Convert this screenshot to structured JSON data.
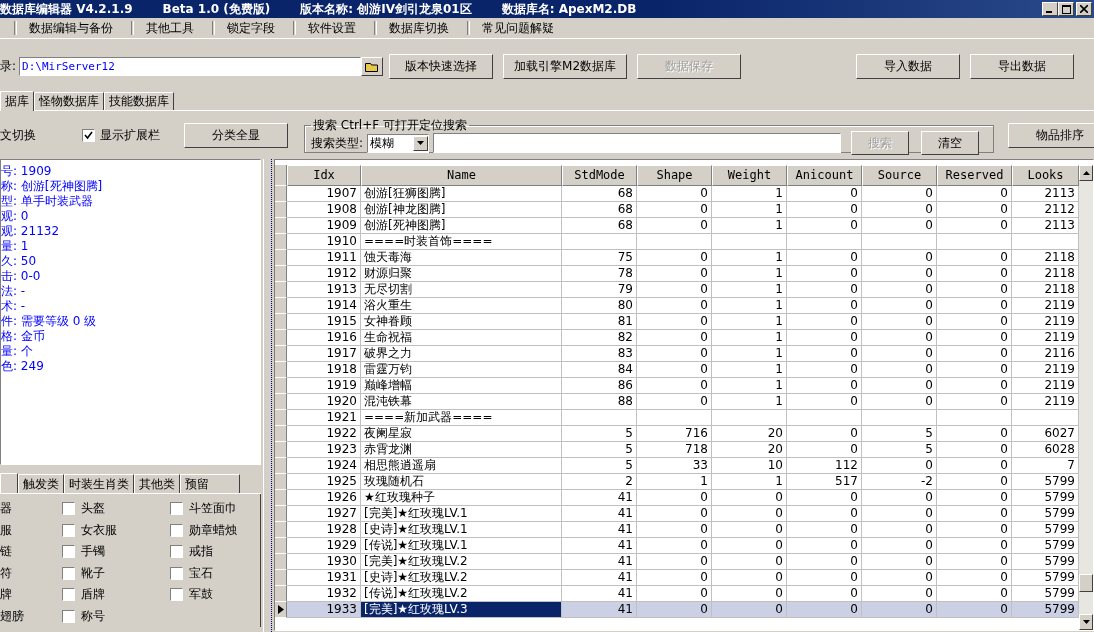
{
  "window": {
    "title_parts": [
      "数据库编辑器 V4.2.1.9",
      "Beta 1.0 (免费版)",
      "版本名称: 创游IV剑引龙泉01区",
      "数据库名: ApexM2.DB"
    ]
  },
  "menu": [
    "数据编辑与备份",
    "其他工具",
    "锁定字段",
    "软件设置",
    "数据库切换",
    "常见问题解疑"
  ],
  "path_bar": {
    "label": "录:",
    "value": "D:\\MirServer12"
  },
  "left_buttons": [
    {
      "label": "版本快速选择",
      "disabled": false
    },
    {
      "label": "加载引擎M2数据库",
      "disabled": false
    },
    {
      "label": "数据保存",
      "disabled": true
    }
  ],
  "right_buttons": [
    {
      "label": "导入数据",
      "disabled": false
    },
    {
      "label": "导出数据",
      "disabled": false
    }
  ],
  "tabs": [
    {
      "label": "据库",
      "selected": true
    },
    {
      "label": "怪物数据库",
      "selected": false
    },
    {
      "label": "技能数据库",
      "selected": false
    }
  ],
  "options": {
    "label": "文切换",
    "show_ext": {
      "label": "显示扩展栏",
      "checked": true
    },
    "show_all_button": "分类全显"
  },
  "search": {
    "legend": "搜索  Ctrl+F 可打开定位搜索",
    "type_label": "搜索类型:",
    "type_value": "模糊",
    "search_button": {
      "label": "搜索",
      "disabled": true
    },
    "clear_button": "清空"
  },
  "sort_button": "物品排序",
  "details": [
    "号: 1909",
    "称: 创游[死神图腾]",
    "型: 单手时装武器",
    "观: 0",
    "观: 21132",
    "量: 1",
    "久: 50",
    "击: 0-0",
    "法: -",
    "术: -",
    "件: 需要等级 0 级",
    "格: 金币",
    "量: 个",
    "色: 249"
  ],
  "category_tabs": [
    "触发类",
    "时装生肖类",
    "其他类",
    "预留"
  ],
  "categories": [
    {
      "label": "器"
    },
    {
      "label": "头盔",
      "checked": false
    },
    {
      "label": "斗笠面巾",
      "checked": false
    },
    {
      "label": "服"
    },
    {
      "label": "女衣服",
      "checked": false
    },
    {
      "label": "勋章蜡烛",
      "checked": false
    },
    {
      "label": "链"
    },
    {
      "label": "手镯",
      "checked": false
    },
    {
      "label": "戒指",
      "checked": false
    },
    {
      "label": "符"
    },
    {
      "label": "靴子",
      "checked": false
    },
    {
      "label": "宝石",
      "checked": false
    },
    {
      "label": "牌"
    },
    {
      "label": "盾牌",
      "checked": false
    },
    {
      "label": "军鼓",
      "checked": false
    },
    {
      "label": "翅膀"
    },
    {
      "label": "称号",
      "checked": false
    }
  ],
  "table": {
    "columns": [
      "Idx",
      "Name",
      "StdMode",
      "Shape",
      "Weight",
      "Anicount",
      "Source",
      "Reserved",
      "Looks"
    ],
    "rows": [
      {
        "idx": "1907",
        "name": "创游[狂狮图腾]",
        "values": [
          "68",
          "0",
          "1",
          "0",
          "0",
          "0",
          "2113"
        ],
        "selected": false
      },
      {
        "idx": "1908",
        "name": "创游[神龙图腾]",
        "values": [
          "68",
          "0",
          "1",
          "0",
          "0",
          "0",
          "2112"
        ],
        "selected": false
      },
      {
        "idx": "1909",
        "name": "创游[死神图腾]",
        "values": [
          "68",
          "0",
          "1",
          "0",
          "0",
          "0",
          "2113"
        ],
        "selected": false
      },
      {
        "idx": "1910",
        "name": "====时装首饰====",
        "selected": false
      },
      {
        "idx": "1911",
        "name": "蚀天毒海",
        "values": [
          "75",
          "0",
          "1",
          "0",
          "0",
          "0",
          "2118"
        ],
        "selected": false
      },
      {
        "idx": "1912",
        "name": "财源归聚",
        "values": [
          "78",
          "0",
          "1",
          "0",
          "0",
          "0",
          "2118"
        ],
        "selected": false
      },
      {
        "idx": "1913",
        "name": "无尽切割",
        "values": [
          "79",
          "0",
          "1",
          "0",
          "0",
          "0",
          "2118"
        ],
        "selected": false
      },
      {
        "idx": "1914",
        "name": "浴火重生",
        "values": [
          "80",
          "0",
          "1",
          "0",
          "0",
          "0",
          "2119"
        ],
        "selected": false
      },
      {
        "idx": "1915",
        "name": "女神眷顾",
        "values": [
          "81",
          "0",
          "1",
          "0",
          "0",
          "0",
          "2119"
        ],
        "selected": false
      },
      {
        "idx": "1916",
        "name": "生命祝福",
        "values": [
          "82",
          "0",
          "1",
          "0",
          "0",
          "0",
          "2119"
        ],
        "selected": false
      },
      {
        "idx": "1917",
        "name": "破界之力",
        "values": [
          "83",
          "0",
          "1",
          "0",
          "0",
          "0",
          "2116"
        ],
        "selected": false
      },
      {
        "idx": "1918",
        "name": "雷霆万钧",
        "values": [
          "84",
          "0",
          "1",
          "0",
          "0",
          "0",
          "2119"
        ],
        "selected": false
      },
      {
        "idx": "1919",
        "name": "巅峰增幅",
        "values": [
          "86",
          "0",
          "1",
          "0",
          "0",
          "0",
          "2119"
        ],
        "selected": false
      },
      {
        "idx": "1920",
        "name": "混沌铁幕",
        "values": [
          "88",
          "0",
          "1",
          "0",
          "0",
          "0",
          "2119"
        ],
        "selected": false
      },
      {
        "idx": "1921",
        "name": "====新加武器====",
        "selected": false
      },
      {
        "idx": "1922",
        "name": "夜阑星寂",
        "values": [
          "5",
          "716",
          "20",
          "0",
          "5",
          "0",
          "6027"
        ],
        "selected": false
      },
      {
        "idx": "1923",
        "name": "赤霄龙渊",
        "values": [
          "5",
          "718",
          "20",
          "0",
          "5",
          "0",
          "6028"
        ],
        "selected": false
      },
      {
        "idx": "1924",
        "name": "相思熊逍遥扇",
        "values": [
          "5",
          "33",
          "10",
          "112",
          "0",
          "0",
          "7"
        ],
        "selected": false
      },
      {
        "idx": "1925",
        "name": "玫瑰随机石",
        "values": [
          "2",
          "1",
          "1",
          "517",
          "-2",
          "0",
          "5799"
        ],
        "selected": false
      },
      {
        "idx": "1926",
        "name": "★红玫瑰种子",
        "values": [
          "41",
          "0",
          "0",
          "0",
          "0",
          "0",
          "5799"
        ],
        "selected": false
      },
      {
        "idx": "1927",
        "name": "[完美]★红玫瑰LV.1",
        "values": [
          "41",
          "0",
          "0",
          "0",
          "0",
          "0",
          "5799"
        ],
        "selected": false
      },
      {
        "idx": "1928",
        "name": "[史诗]★红玫瑰LV.1",
        "values": [
          "41",
          "0",
          "0",
          "0",
          "0",
          "0",
          "5799"
        ],
        "selected": false
      },
      {
        "idx": "1929",
        "name": "[传说]★红玫瑰LV.1",
        "values": [
          "41",
          "0",
          "0",
          "0",
          "0",
          "0",
          "5799"
        ],
        "selected": false
      },
      {
        "idx": "1930",
        "name": "[完美]★红玫瑰LV.2",
        "values": [
          "41",
          "0",
          "0",
          "0",
          "0",
          "0",
          "5799"
        ],
        "selected": false
      },
      {
        "idx": "1931",
        "name": "[史诗]★红玫瑰LV.2",
        "values": [
          "41",
          "0",
          "0",
          "0",
          "0",
          "0",
          "5799"
        ],
        "selected": false
      },
      {
        "idx": "1932",
        "name": "[传说]★红玫瑰LV.2",
        "values": [
          "41",
          "0",
          "0",
          "0",
          "0",
          "0",
          "5799"
        ],
        "selected": false
      },
      {
        "idx": "1933",
        "name": "[完美]★红玫瑰LV.3",
        "values": [
          "41",
          "0",
          "0",
          "0",
          "0",
          "0",
          "5799"
        ],
        "selected": true
      }
    ]
  }
}
